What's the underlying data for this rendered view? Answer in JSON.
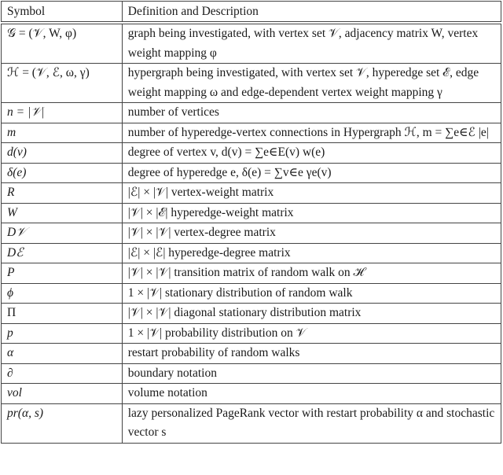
{
  "table": {
    "headers": {
      "symbol": "Symbol",
      "definition": "Definition and Description"
    },
    "rows": [
      {
        "symbol": "𝒢 = (𝒱, W, φ)",
        "definition": "graph being investigated, with vertex set 𝒱, adjacency matrix W, vertex weight mapping φ"
      },
      {
        "symbol": "ℋ = (𝒱, ℰ, ω, γ)",
        "definition": "hypergraph being investigated, with vertex set 𝒱, hyperedge set ℰ, edge weight mapping ω and edge-dependent vertex weight mapping γ"
      },
      {
        "symbol": "n = |𝒱|",
        "definition": "number of vertices"
      },
      {
        "symbol": "m",
        "definition": "number of hyperedge-vertex connections in Hypergraph ℋ, m = ∑e∈ℰ |e|"
      },
      {
        "symbol": "d(v)",
        "definition": "degree of vertex v, d(v) = ∑e∈E(v) w(e)"
      },
      {
        "symbol": "δ(e)",
        "definition": "degree of hyperedge e, δ(e) = ∑v∈e γe(v)"
      },
      {
        "symbol": "R",
        "definition": "|ℰ| × |𝒱| vertex-weight matrix"
      },
      {
        "symbol": "W",
        "definition": "|𝒱| × |ℰ| hyperedge-weight matrix"
      },
      {
        "symbol": "D𝒱",
        "definition": "|𝒱| × |𝒱| vertex-degree matrix"
      },
      {
        "symbol": "Dℰ",
        "definition": "|ℰ| × |ℰ| hyperedge-degree matrix"
      },
      {
        "symbol": "P",
        "definition": "|𝒱| × |𝒱| transition matrix of random walk on ℋ"
      },
      {
        "symbol": "ϕ",
        "definition": "1 × |𝒱| stationary distribution of random walk"
      },
      {
        "symbol": "Π",
        "definition": "|𝒱| × |𝒱| diagonal stationary distribution matrix"
      },
      {
        "symbol": "p",
        "definition": "1 × |𝒱| probability distribution on 𝒱"
      },
      {
        "symbol": "α",
        "definition": "restart probability of random walks"
      },
      {
        "symbol": "∂",
        "definition": "boundary notation"
      },
      {
        "symbol": "vol",
        "definition": "volume notation"
      },
      {
        "symbol": "pr(α, s)",
        "definition": "lazy personalized PageRank vector with restart probability α and stochastic vector s"
      }
    ]
  }
}
